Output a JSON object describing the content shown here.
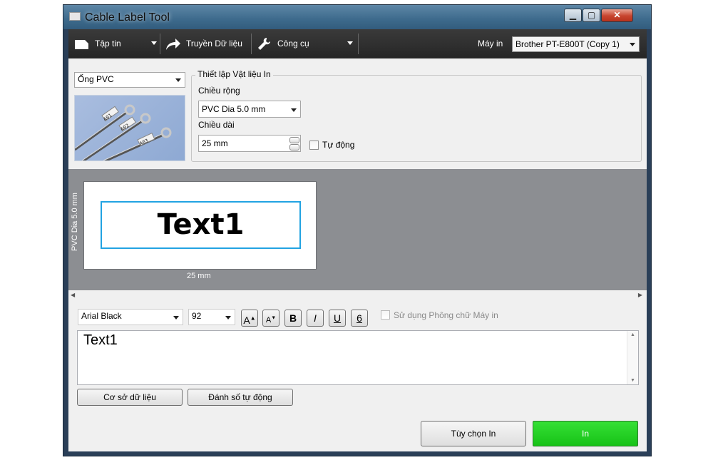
{
  "window": {
    "title": "Cable Label Tool"
  },
  "toolbar": {
    "file_label": "Tập tin",
    "transfer_label": "Truyền Dữ liệu",
    "tools_label": "Công cụ",
    "printer_label": "Máy in",
    "printer_value": "Brother PT-E800T (Copy 1)"
  },
  "media": {
    "type_value": "Ống PVC",
    "settings_group_title": "Thiết lập Vật liệu In",
    "width_label": "Chiều rộng",
    "width_value": "PVC Dia 5.0 mm",
    "length_label": "Chiều dài",
    "length_value": "25 mm",
    "auto_label": "Tự động",
    "sample_tags": [
      "A01",
      "A02",
      "A03"
    ]
  },
  "preview": {
    "label_text": "Text1",
    "vertical_label": "PVC Dia 5.0 mm",
    "horizontal_label": "25 mm"
  },
  "format": {
    "font_value": "Arial Black",
    "size_value": "92",
    "bold": "B",
    "italic": "I",
    "underline": "U",
    "frame": "6",
    "printer_font_label": "Sử dụng Phông chữ Máy in"
  },
  "editor": {
    "text": "Text1"
  },
  "buttons": {
    "database": "Cơ sở dữ liệu",
    "auto_number": "Đánh số tự động",
    "print_options": "Tùy chọn In",
    "print": "In"
  },
  "colors": {
    "print_button": "#1ec81e",
    "print_area_border": "#22a3e2",
    "toolbar": "#2e2e2e"
  }
}
